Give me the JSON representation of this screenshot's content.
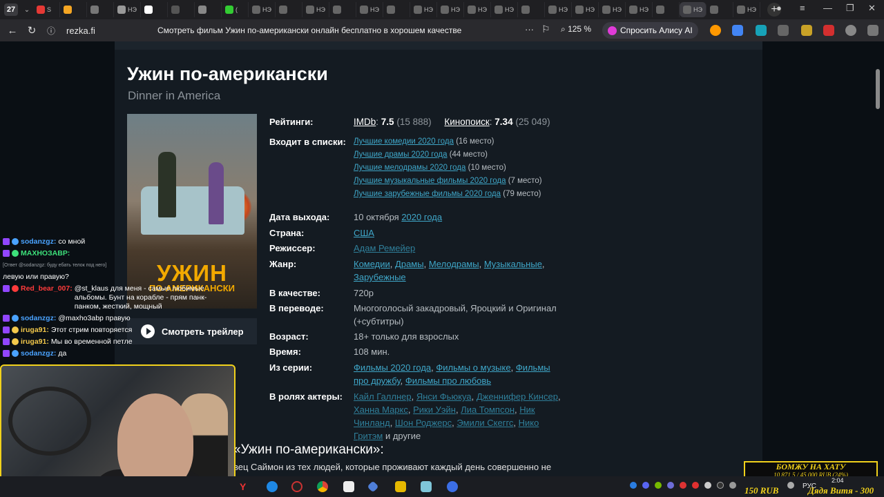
{
  "browser": {
    "tab_count": "27",
    "address": "rezka.fi",
    "page_title": "Смотреть фильм Ужин по-американски онлайн бесплатно в хорошем качестве",
    "zoom": "125 %",
    "alice_label": "Спросить Алису AI",
    "tab_labels": [
      "S",
      "",
      "",
      "НЭ",
      "",
      "",
      "",
      "(",
      "НЭ",
      "",
      "НЭ",
      "",
      "НЭ",
      "",
      "НЭ",
      "НЭ",
      "НЭ",
      "НЭ",
      "",
      "НЭ",
      "НЭ",
      "НЭ",
      "НЭ",
      "",
      "НЭ",
      "",
      "НЭ"
    ]
  },
  "movie": {
    "title": "Ужин по-американски",
    "original_title": "Dinner in America",
    "poster": {
      "title": "УЖИН",
      "subtitle": "ПО-АМЕРИКАНСКИ"
    },
    "trailer_button": "Смотреть трейлер",
    "labels": {
      "ratings": "Рейтинги:",
      "lists": "Входит в списки:",
      "release": "Дата выхода:",
      "country": "Страна:",
      "director": "Режиссер:",
      "genre": "Жанр:",
      "quality": "В качестве:",
      "translation": "В переводе:",
      "age": "Возраст:",
      "duration": "Время:",
      "series": "Из серии:",
      "cast": "В ролях актеры:"
    },
    "ratings": {
      "imdb_label": "IMDb",
      "imdb_value": "7.5",
      "imdb_votes": "(15 888)",
      "kp_label": "Кинопоиск",
      "kp_value": "7.34",
      "kp_votes": "(25 049)"
    },
    "lists": [
      {
        "name": "Лучшие комедии 2020 года",
        "place": "(16 место)"
      },
      {
        "name": "Лучшие драмы 2020 года",
        "place": "(44 место)"
      },
      {
        "name": "Лучшие мелодрамы 2020 года",
        "place": "(10 место)"
      },
      {
        "name": "Лучшие музыкальные фильмы 2020 года",
        "place": "(7 место)"
      },
      {
        "name": "Лучшие зарубежные фильмы 2020 года",
        "place": "(79 место)"
      }
    ],
    "release_date": "10 октября",
    "release_year": "2020 года",
    "country": "США",
    "director": "Адам Ремейер",
    "genres": [
      "Комедии",
      "Драмы",
      "Мелодрамы",
      "Музыкальные",
      "Зарубежные"
    ],
    "quality": "720p",
    "translation": "Многоголосый закадровый, Яроцкий и Оригинал (+субтитры)",
    "age": "18+ только для взрослых",
    "duration": "108 мин.",
    "series": [
      "Фильмы 2020 года",
      "Фильмы о музыке",
      "Фильмы про дружбу",
      "Фильмы про любовь"
    ],
    "cast": [
      "Кайл Галлнер",
      "Янси Фьюкуа",
      "Дженнифер Кинсер",
      "Ханна Маркс",
      "Рики Уэйн",
      "Лиа Томпсон",
      "Ник Чинланд",
      "Шон Роджерс",
      "Эмили Скеггс",
      "Нико Гритэм"
    ],
    "cast_more": "и другие",
    "about_heading": "«Ужин по-американски»:",
    "description": "вец Саймон из тех людей, которые проживают каждый день совершенно не"
  },
  "chat": [
    {
      "nick": "sodanzgz:",
      "color": "#4aa3ff",
      "text": "со мной"
    },
    {
      "nick": "МАХНОЗАВР:",
      "color": "#3de07a",
      "text": ""
    },
    {
      "nick": "",
      "color": "#9aa0a6",
      "text": "[Ответ @sodanzgz: буду ебать телок под него]"
    },
    {
      "nick": "",
      "color": "#ffffff",
      "text": "левую или правую?"
    },
    {
      "nick": "Red_bear_007:",
      "color": "#ff3b3b",
      "text": "@st_klaus для меня - самые любимые альбомы. Бунт на корабле - прям панк-панком, жесткий, мощный"
    },
    {
      "nick": "sodanzgz:",
      "color": "#4aa3ff",
      "text": "@maxho3abp правую"
    },
    {
      "nick": "iruga91:",
      "color": "#f2c84b",
      "text": "Этот стрим повторяется"
    },
    {
      "nick": "iruga91:",
      "color": "#f2c84b",
      "text": "Мы во временной петле"
    },
    {
      "nick": "sodanzgz:",
      "color": "#4aa3ff",
      "text": "да"
    }
  ],
  "donation": {
    "line1": "БОМЖУ НА ХАТУ",
    "line2": "10 871,5 / 45 000 RUB (24%)",
    "progress_percent": 24
  },
  "overlay": {
    "left_text": "150 RUB",
    "right_text": "Дядя Витя - 300"
  },
  "taskbar": {
    "lang": "РУС",
    "time": "2:04"
  }
}
